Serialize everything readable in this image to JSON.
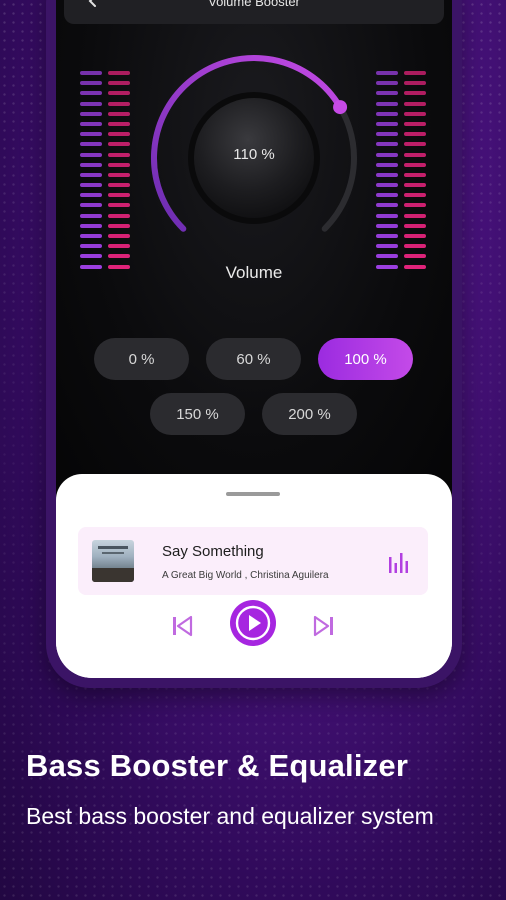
{
  "app": {
    "header_title": "Volume Booster"
  },
  "knob": {
    "value_text": "110 %",
    "label": "Volume",
    "level_fraction": 0.72
  },
  "presets": [
    {
      "label": "0 %",
      "active": false
    },
    {
      "label": "60 %",
      "active": false
    },
    {
      "label": "100 %",
      "active": true
    },
    {
      "label": "150 %",
      "active": false
    },
    {
      "label": "200 %",
      "active": false
    }
  ],
  "player": {
    "title": "Say Something",
    "artist": "A  Great Big World , Christina Aguilera",
    "icons": [
      "equalizer-icon",
      "previous-icon",
      "play-icon",
      "next-icon"
    ]
  },
  "caption": {
    "title": "Bass Booster & Equalizer",
    "subtitle": "Best bass booster and equalizer system"
  },
  "colors": {
    "accent_purple": "#a23be2",
    "eq_purple": "#9b3fe0",
    "eq_pink": "#e0237a",
    "card_bg": "#fbeefb",
    "dark_bg": "#0b0b0d"
  }
}
